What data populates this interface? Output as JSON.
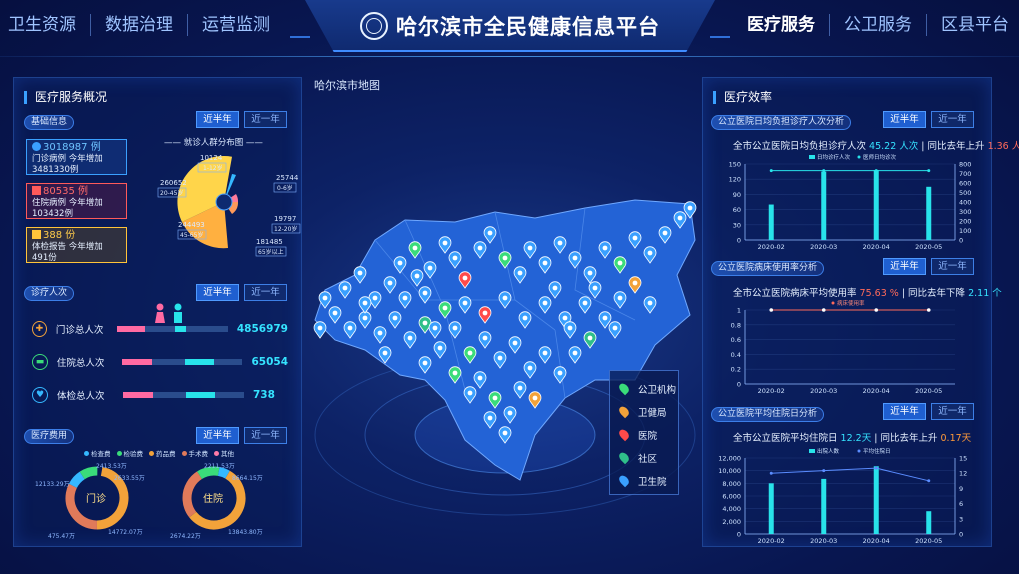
{
  "header": {
    "title": "哈尔滨市全民健康信息平台",
    "nav_left": [
      "卫生资源",
      "数据治理",
      "运营监测"
    ],
    "nav_right": [
      "医疗服务",
      "公卫服务",
      "区县平台"
    ],
    "active_tab": "医疗服务"
  },
  "left_panel": {
    "title": "医疗服务概况",
    "basic_info": {
      "tag": "基础信息",
      "btn_half_year": "近半年",
      "btn_year": "近一年",
      "cards": [
        {
          "value": "3018987 例",
          "line2": "门诊病例  今年增加",
          "line3": "3481330例",
          "color": "#3aa0ff"
        },
        {
          "value": "80535 例",
          "line2": "住院病例  今年增加",
          "line3": "103432例",
          "color": "#ff5a5a"
        },
        {
          "value": "388 份",
          "line2": "体检报告  今年增加",
          "line3": "491份",
          "color": "#ffc43a"
        }
      ],
      "pie_title": "—— 就诊人群分布图 ——",
      "pie_segments": [
        {
          "value": "10124",
          "range": "1-12岁"
        },
        {
          "value": "25744",
          "range": "0-6岁"
        },
        {
          "value": "19797",
          "range": "12-20岁"
        },
        {
          "value": "181485",
          "range": "65岁以上"
        },
        {
          "value": "244493",
          "range": "45-65岁"
        },
        {
          "value": "260652",
          "range": "20-45岁"
        }
      ]
    },
    "visits": {
      "tag": "诊疗人次",
      "btn_half_year": "近半年",
      "btn_year": "近一年",
      "rows": [
        {
          "label": "门诊总人次",
          "value": "4856979",
          "female_pct": 0.5,
          "male_pct": 0.22,
          "icon_color": "#f2a23a",
          "icon": "✚"
        },
        {
          "label": "住院总人次",
          "value": "65054",
          "female_pct": 0.5,
          "male_pct": 0.5,
          "icon_color": "#3adc7a",
          "icon": "▬"
        },
        {
          "label": "体检总人次",
          "value": "738",
          "female_pct": 0.5,
          "male_pct": 0.5,
          "icon_color": "#35b8ff",
          "icon": "♥"
        }
      ]
    },
    "fees": {
      "tag": "医疗费用",
      "btn_half_year": "近半年",
      "btn_year": "近一年",
      "legend": [
        "检查费",
        "检验费",
        "药品费",
        "手术费",
        "其他"
      ],
      "legend_colors": [
        "#35b8ff",
        "#3adc7a",
        "#f2a23a",
        "#e07a5a",
        "#ff7aa8"
      ],
      "outpatient": {
        "label": "门诊",
        "labels": [
          "2413.53万",
          "2633.55万",
          "12133.29万",
          "475.47万",
          "14772.07万"
        ]
      },
      "inpatient": {
        "label": "住院",
        "labels": [
          "2211.53万",
          "8664.15万",
          "2674.22万",
          "13843.80万"
        ]
      }
    }
  },
  "map": {
    "title": "哈尔滨市地图",
    "legend": [
      {
        "label": "公卫机构",
        "color": "#3adc7a"
      },
      {
        "label": "卫健局",
        "color": "#f2a23a"
      },
      {
        "label": "医院",
        "color": "#ff4a4a"
      },
      {
        "label": "社区",
        "color": "#2fbf8a"
      },
      {
        "label": "卫生院",
        "color": "#3aa0ff"
      }
    ]
  },
  "right_panel": {
    "title": "医疗效率",
    "charts": [
      {
        "tag": "公立医院日均负担诊疗人次分析",
        "btn_half_year": "近半年",
        "btn_year": "近一年",
        "head_prefix": "全市公立医院日均负担诊疗人次",
        "head_value": "45.22 人次",
        "head_mid": "| 同比去年上升",
        "head_change": "1.36 人次",
        "head_change_color": "#ff6a5a"
      },
      {
        "tag": "公立医院病床使用率分析",
        "btn_half_year": "近半年",
        "btn_year": "近一年",
        "head_prefix": "全市公立医院病床平均使用率",
        "head_value": "75.63 %",
        "head_mid": "| 同比去年下降",
        "head_change": "2.11 个",
        "head_change_color": "#35e3ff"
      },
      {
        "tag": "公立医院平均住院日分析",
        "btn_half_year": "近半年",
        "btn_year": "近一年",
        "head_prefix": "全市公立医院平均住院日",
        "head_value": "12.2天",
        "head_mid": "| 同比去年上升",
        "head_change": "0.17天",
        "head_change_color": "#ff9a3a"
      }
    ]
  },
  "chart_data": [
    {
      "type": "bar",
      "categories": [
        "2020-02",
        "2020-03",
        "2020-04",
        "2020-05"
      ],
      "series": [
        {
          "name": "日均诊疗人次",
          "values": [
            70,
            135,
            138,
            105
          ]
        },
        {
          "name": "医师日均诊次",
          "values": [
            730,
            730,
            730,
            730
          ]
        }
      ],
      "ylim": [
        0,
        150
      ],
      "y2lim": [
        0,
        800
      ],
      "yticks": [
        0,
        30,
        60,
        90,
        120,
        150
      ],
      "y2ticks": [
        0,
        100,
        200,
        300,
        400,
        500,
        600,
        700,
        800
      ]
    },
    {
      "type": "line",
      "categories": [
        "2020-02",
        "2020-03",
        "2020-04",
        "2020-05"
      ],
      "series": [
        {
          "name": "病床使用率",
          "values": [
            1,
            1,
            1,
            1
          ]
        }
      ],
      "ylim": [
        0,
        1
      ],
      "yticks": [
        0,
        0.2,
        0.4,
        0.6,
        0.8,
        1
      ]
    },
    {
      "type": "bar",
      "categories": [
        "2020-02",
        "2020-03",
        "2020-04",
        "2020-05"
      ],
      "series": [
        {
          "name": "出院人数",
          "values": [
            8000,
            8700,
            10700,
            3600
          ]
        },
        {
          "name": "平均住院日",
          "values": [
            12,
            12.5,
            13,
            10.5
          ]
        }
      ],
      "ylim": [
        0,
        12000
      ],
      "y2lim": [
        0,
        15
      ],
      "yticks": [
        0,
        2000,
        4000,
        6000,
        8000,
        10000,
        12000
      ],
      "y2ticks": [
        0,
        3,
        6,
        9,
        12,
        15
      ]
    }
  ]
}
